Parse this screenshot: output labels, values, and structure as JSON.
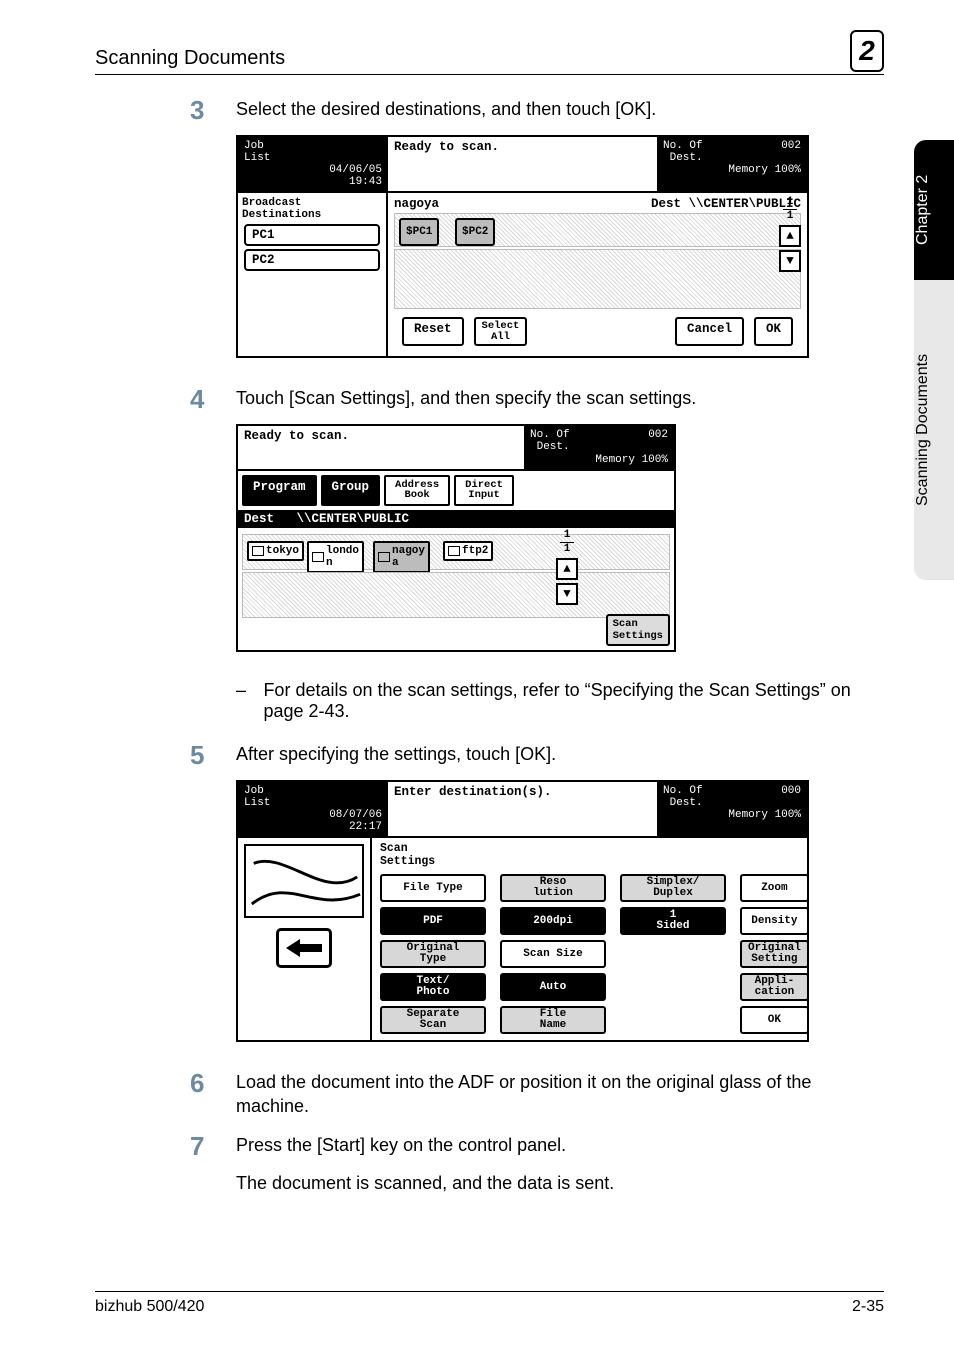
{
  "header": {
    "title": "Scanning Documents",
    "chapter_badge": "2"
  },
  "side_tab": {
    "dark": "Chapter 2",
    "light": "Scanning Documents"
  },
  "steps": {
    "s3": {
      "num": "3",
      "text": "Select the desired destinations, and then touch [OK]."
    },
    "s4": {
      "num": "4",
      "text": "Touch [Scan Settings], and then specify the scan settings."
    },
    "s4_note": "For details on the scan settings, refer to “Specifying the Scan Settings” on page 2-43.",
    "s5": {
      "num": "5",
      "text": "After specifying the settings, touch [OK]."
    },
    "s6": {
      "num": "6",
      "text": "Load the document into the ADF or position it on the original glass of the machine."
    },
    "s7": {
      "num": "7",
      "text": "Press the [Start] key on the control panel."
    },
    "s7_result": "The document is scanned, and the data is sent."
  },
  "screen1": {
    "job_list": "Job\nList",
    "datetime": "04/06/05\n19:43",
    "status": "Ready to scan.",
    "noof_label": "No. Of\nDest.",
    "noof_value": "002",
    "memory": "Memory 100%",
    "side_title": "Broadcast\nDestinations",
    "pc1": "PC1",
    "pc2": "PC2",
    "dest_name": "nagoya",
    "dest_label": "Dest",
    "dest_path": "\\\\CENTER\\PUBLIC",
    "chip_pc1": "$PC1",
    "chip_pc2": "$PC2",
    "frac_top": "1",
    "frac_bot": "1",
    "reset": "Reset",
    "select_all": "Select\nAll",
    "cancel": "Cancel",
    "ok": "OK"
  },
  "screen2": {
    "status": "Ready to scan.",
    "noof_label": "No. Of\nDest.",
    "noof_value": "002",
    "memory": "Memory 100%",
    "tab_program": "Program",
    "tab_group": "Group",
    "tab_addr": "Address\nBook",
    "tab_direct": "Direct\nInput",
    "dest_label": "Dest",
    "dest_path": "\\\\CENTER\\PUBLIC",
    "chip_tokyo": "tokyo",
    "chip_london": "londo\nn",
    "chip_nagoya": "nagoy\na",
    "chip_ftp2": "ftp2",
    "frac_top": "1",
    "frac_bot": "1",
    "scan_settings": "Scan\nSettings"
  },
  "screen3": {
    "job_list": "Job\nList",
    "datetime": "08/07/06\n22:17",
    "status": "Enter destination(s).",
    "noof_label": "No. Of\nDest.",
    "noof_value": "000",
    "memory": "Memory 100%",
    "title": "Scan\nSettings",
    "file_type": "File Type",
    "file_type_val": "PDF",
    "resolution": "Reso\nlution",
    "resolution_val": "200dpi",
    "simplex": "Simplex/\nDuplex",
    "simplex_val": "1\nSided",
    "original_type": "Original\nType",
    "original_type_val": "Text/\nPhoto",
    "scan_size": "Scan Size",
    "scan_size_val": "Auto",
    "zoom": "Zoom",
    "density": "Density",
    "original_setting": "Original\nSetting",
    "application": "Appli-\ncation",
    "separate": "Separate\nScan",
    "file_name": "File\nName",
    "ok": "OK"
  },
  "footer": {
    "left": "bizhub 500/420",
    "right": "2-35"
  }
}
